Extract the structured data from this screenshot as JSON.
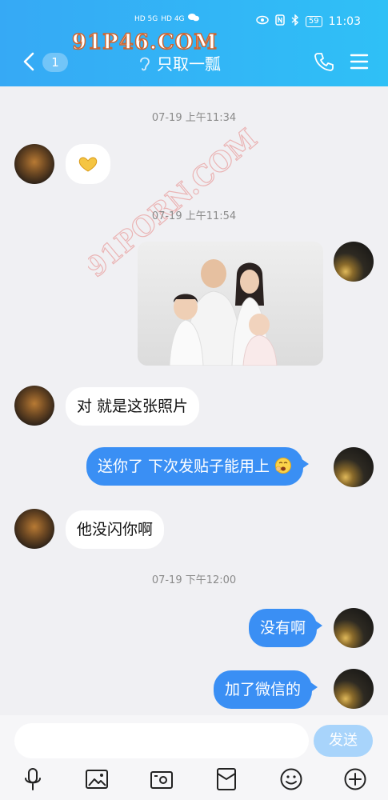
{
  "status_bar": {
    "time": "11:03",
    "battery": "59",
    "net_left": "HD 5G",
    "net_right": "HD 4G"
  },
  "watermark": {
    "top": "91P46.COM",
    "diagonal": "91PORN.COM"
  },
  "header": {
    "unread_count": "1",
    "title": "只取一瓢"
  },
  "messages": [
    {
      "type": "time",
      "text": "07-19 上午11:34"
    },
    {
      "type": "in",
      "emoji": "heart-hands-emoji"
    },
    {
      "type": "time",
      "text": "07-19 上午11:54"
    },
    {
      "type": "out",
      "image": "family-photo"
    },
    {
      "type": "in",
      "text": "对 就是这张照片"
    },
    {
      "type": "out",
      "text": "送你了 下次发贴子能用上"
    },
    {
      "type": "in",
      "text": "他没闪你啊"
    },
    {
      "type": "time",
      "text": "07-19 下午12:00"
    },
    {
      "type": "out",
      "text": "没有啊"
    },
    {
      "type": "out",
      "text": "加了微信的"
    }
  ],
  "input": {
    "value": "",
    "send_label": "发送"
  },
  "toolbar": [
    "mic-icon",
    "image-icon",
    "camera-icon",
    "red-packet-icon",
    "emoji-icon",
    "plus-icon"
  ],
  "colors": {
    "header": "#36a9f5",
    "bubble_out": "#3a8ff4",
    "send_disabled": "#a8d4fb"
  }
}
